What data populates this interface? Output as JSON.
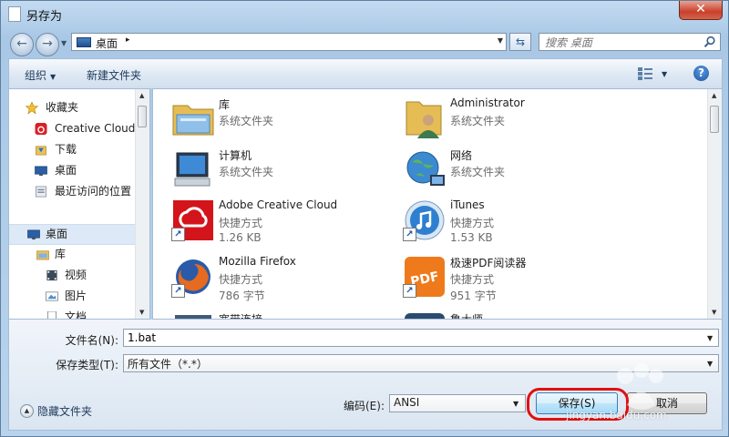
{
  "window": {
    "title": "另存为",
    "close_label": "✕"
  },
  "address_bar": {
    "path": [
      "桌面"
    ],
    "separator": "▸"
  },
  "search": {
    "placeholder": "搜索 桌面"
  },
  "toolbar": {
    "organize_label": "组织",
    "new_folder_label": "新建文件夹",
    "help_label": "?"
  },
  "nav_pane": {
    "favorites": [
      {
        "label": "收藏夹",
        "icon": "star-icon"
      },
      {
        "label": "Creative Cloud",
        "icon": "creative-cloud-icon"
      },
      {
        "label": "下载",
        "icon": "downloads-icon"
      },
      {
        "label": "桌面",
        "icon": "desktop-icon"
      },
      {
        "label": "最近访问的位置",
        "icon": "recent-places-icon"
      }
    ],
    "tree": [
      {
        "label": "桌面",
        "icon": "desktop-icon",
        "selected": true
      },
      {
        "label": "库",
        "icon": "library-icon"
      },
      {
        "label": "视频",
        "icon": "video-icon"
      },
      {
        "label": "图片",
        "icon": "pictures-icon"
      },
      {
        "label": "文档",
        "icon": "documents-icon"
      }
    ]
  },
  "files": [
    {
      "name": "库",
      "type": "系统文件夹",
      "size": "",
      "icon": "library-folder-icon"
    },
    {
      "name": "Administrator",
      "type": "系统文件夹",
      "size": "",
      "icon": "user-folder-icon"
    },
    {
      "name": "计算机",
      "type": "系统文件夹",
      "size": "",
      "icon": "computer-icon"
    },
    {
      "name": "网络",
      "type": "系统文件夹",
      "size": "",
      "icon": "network-icon"
    },
    {
      "name": "Adobe Creative Cloud",
      "type": "快捷方式",
      "size": "1.26 KB",
      "icon": "adobe-cc-icon"
    },
    {
      "name": "iTunes",
      "type": "快捷方式",
      "size": "1.53 KB",
      "icon": "itunes-icon"
    },
    {
      "name": "Mozilla Firefox",
      "type": "快捷方式",
      "size": "786 字节",
      "icon": "firefox-icon"
    },
    {
      "name": "极速PDF阅读器",
      "type": "快捷方式",
      "size": "951 字节",
      "icon": "pdf-reader-icon"
    },
    {
      "name": "宽带连接",
      "type": "",
      "size": "",
      "icon": "broadband-icon"
    },
    {
      "name": "鲁大师",
      "type": "",
      "size": "",
      "icon": "ludashi-icon"
    }
  ],
  "form": {
    "filename_label": "文件名(N):",
    "filename_value": "1.bat",
    "filetype_label": "保存类型(T):",
    "filetype_value": "所有文件（*.*）",
    "encoding_label": "编码(E):",
    "encoding_value": "ANSI",
    "hide_folders_label": "隐藏文件夹",
    "save_label": "保存(S)",
    "cancel_label": "取消"
  },
  "watermark": {
    "text": "jingyan.baidu.com"
  },
  "colors": {
    "selection": "#dde9f6",
    "annotation_red": "#e01010",
    "title_close": "#c9402b"
  }
}
